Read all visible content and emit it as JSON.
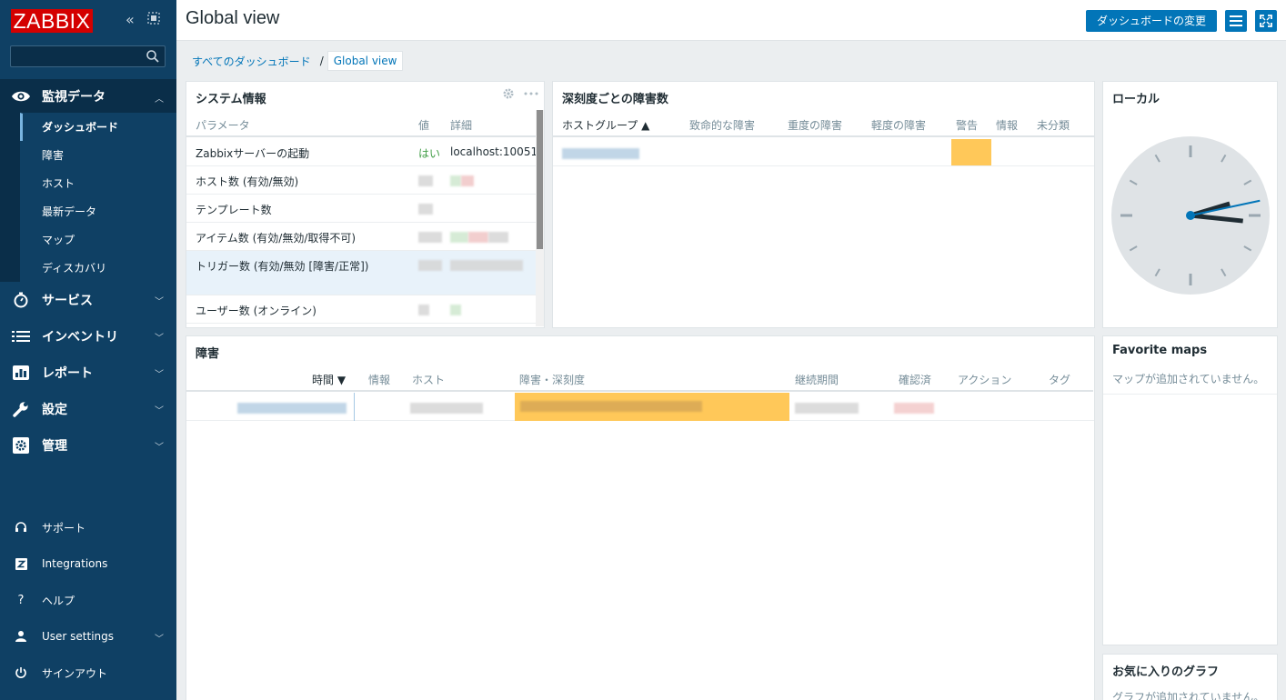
{
  "brand": {
    "logo_text": "ZABBIX",
    "accent": "#0275b8",
    "logo_color": "#d40000",
    "sidebar_color": "#0f4064"
  },
  "sidebar": {
    "search_placeholder": "",
    "main_menu": [
      {
        "label": "監視データ",
        "icon": "eye-icon",
        "expanded": true
      },
      {
        "label": "サービス",
        "icon": "stopwatch-icon"
      },
      {
        "label": "インベントリ",
        "icon": "list-icon"
      },
      {
        "label": "レポート",
        "icon": "bar-chart-icon"
      },
      {
        "label": "設定",
        "icon": "wrench-icon"
      },
      {
        "label": "管理",
        "icon": "gear-box-icon"
      }
    ],
    "submenu": [
      "ダッシュボード",
      "障害",
      "ホスト",
      "最新データ",
      "マップ",
      "ディスカバリ"
    ],
    "bottom_menu": [
      {
        "label": "サポート",
        "icon": "headset-icon"
      },
      {
        "label": "Integrations",
        "icon": "z-icon"
      },
      {
        "label": "ヘルプ",
        "icon": "question-icon"
      },
      {
        "label": "User settings",
        "icon": "user-icon"
      },
      {
        "label": "サインアウト",
        "icon": "power-icon"
      }
    ]
  },
  "header": {
    "title": "Global view",
    "edit_button": "ダッシュボードの変更"
  },
  "breadcrumb": {
    "root": "すべてのダッシュボード",
    "current": "Global view"
  },
  "system_info": {
    "title": "システム情報",
    "columns": [
      "パラメータ",
      "値",
      "詳細"
    ],
    "rows": [
      {
        "param": "Zabbixサーバーの起動",
        "value": "はい",
        "detail": "localhost:10051"
      },
      {
        "param": "ホスト数 (有効/無効)",
        "value": "",
        "detail": ""
      },
      {
        "param": "テンプレート数",
        "value": "",
        "detail": ""
      },
      {
        "param": "アイテム数 (有効/無効/取得不可)",
        "value": "",
        "detail": ""
      },
      {
        "param": "トリガー数 (有効/無効 [障害/正常])",
        "value": "",
        "detail": ""
      },
      {
        "param": "ユーザー数 (オンライン)",
        "value": "",
        "detail": ""
      }
    ]
  },
  "severity": {
    "title": "深刻度ごとの障害数",
    "columns": [
      "ホストグループ ▲",
      "致命的な障害",
      "重度の障害",
      "軽度の障害",
      "警告",
      "情報",
      "未分類"
    ],
    "warning_color": "#ffc859"
  },
  "clock": {
    "title": "ローカル",
    "hour": 3,
    "minute": 12,
    "second": 13
  },
  "problems": {
    "title": "障害",
    "columns": [
      "時間 ▼",
      "情報",
      "ホスト",
      "障害・深刻度",
      "継続期間",
      "確認済",
      "アクション",
      "タグ"
    ]
  },
  "favorite_maps": {
    "title": "Favorite maps",
    "empty": "マップが追加されていません。"
  },
  "favorite_graphs": {
    "title": "お気に入りのグラフ",
    "empty": "グラフが追加されていません。"
  }
}
